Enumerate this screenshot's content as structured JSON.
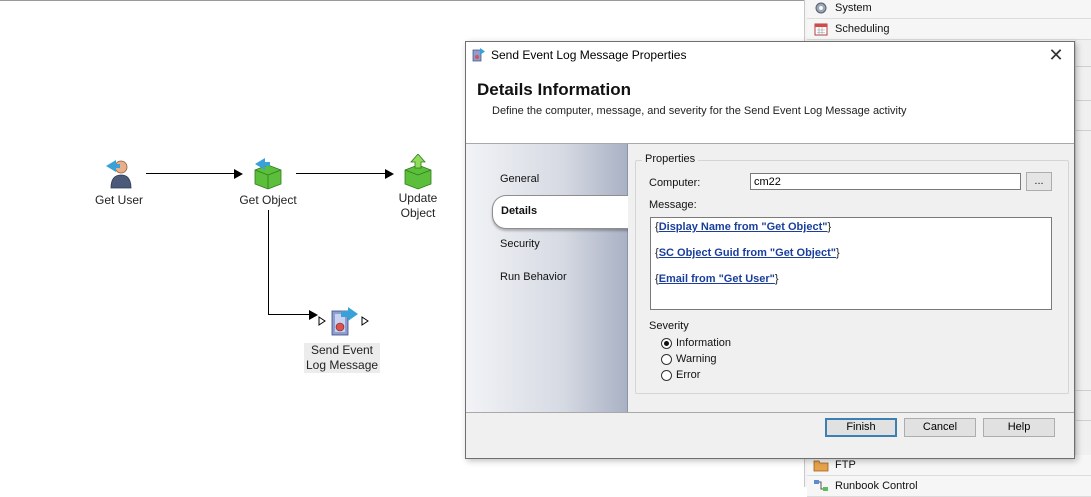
{
  "canvas": {
    "activities": [
      {
        "label": "Get User"
      },
      {
        "label": "Get Object"
      },
      {
        "label_line1": "Update",
        "label_line2": "Object"
      },
      {
        "label_line1": "Send Event",
        "label_line2": "Log Message"
      }
    ]
  },
  "activity_panel": {
    "items": [
      {
        "label": "System",
        "icon": "gear-icon"
      },
      {
        "label": "Scheduling",
        "icon": "calendar-icon"
      },
      {
        "label": "FTP",
        "icon": "folder-icon"
      },
      {
        "label": "Runbook Control",
        "icon": "flow-icon"
      }
    ]
  },
  "dialog": {
    "title": "Send Event Log Message Properties",
    "close_glyph": "✕",
    "header_title": "Details Information",
    "header_subtitle": "Define the computer, message, and severity for the Send Event Log Message activity",
    "nav": {
      "general": "General",
      "details": "Details",
      "security": "Security",
      "run_behavior": "Run Behavior"
    },
    "properties": {
      "group_title": "Properties",
      "computer_label": "Computer:",
      "computer_value": "cm22",
      "browse_label": "...",
      "message_label": "Message:",
      "message_tokens": [
        {
          "open": "{",
          "text": "Display Name from \"Get Object\"",
          "close": "}"
        },
        {
          "open": "{",
          "text": "SC Object Guid from \"Get Object\"",
          "close": "}"
        },
        {
          "open": "{",
          "text": "Email from \"Get User\"",
          "close": "}"
        }
      ],
      "severity_label": "Severity",
      "severity_options": [
        "Information",
        "Warning",
        "Error"
      ],
      "severity_selected": "Information"
    },
    "buttons": {
      "finish": "Finish",
      "cancel": "Cancel",
      "help": "Help"
    }
  }
}
